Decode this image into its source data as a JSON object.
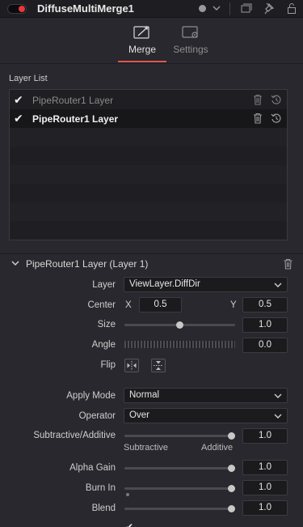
{
  "titlebar": {
    "title": "DiffuseMultiMerge1"
  },
  "tabs": [
    {
      "label": "Merge",
      "active": true
    },
    {
      "label": "Settings",
      "active": false
    }
  ],
  "layer_list": {
    "label": "Layer List",
    "items": [
      {
        "name": "PipeRouter1 Layer",
        "checked": true,
        "state": "dim"
      },
      {
        "name": "PipeRouter1 Layer",
        "checked": true,
        "state": "selected"
      }
    ]
  },
  "group": {
    "title": "PipeRouter1 Layer (Layer 1)"
  },
  "controls": {
    "layer": {
      "label": "Layer",
      "value": "ViewLayer.DiffDir"
    },
    "center": {
      "label": "Center",
      "x_label": "X",
      "x_value": "0.5",
      "y_label": "Y",
      "y_value": "0.5"
    },
    "size": {
      "label": "Size",
      "value": "1.0",
      "slider_fraction": 0.5
    },
    "angle": {
      "label": "Angle",
      "value": "0.0"
    },
    "flip": {
      "label": "Flip"
    },
    "apply_mode": {
      "label": "Apply Mode",
      "value": "Normal"
    },
    "operator": {
      "label": "Operator",
      "value": "Over"
    },
    "subtractive_additive": {
      "label": "Subtractive/Additive",
      "value": "1.0",
      "left_caption": "Subtractive",
      "right_caption": "Additive",
      "slider_fraction": 1.0
    },
    "alpha_gain": {
      "label": "Alpha Gain",
      "value": "1.0",
      "slider_fraction": 1.0
    },
    "burn_in": {
      "label": "Burn In",
      "value": "1.0",
      "slider_fraction": 1.0
    },
    "blend": {
      "label": "Blend",
      "value": "1.0",
      "slider_fraction": 1.0
    }
  },
  "colors": {
    "accent": "#e0554d",
    "background": "#28282e",
    "field": "#1b1b1e"
  }
}
